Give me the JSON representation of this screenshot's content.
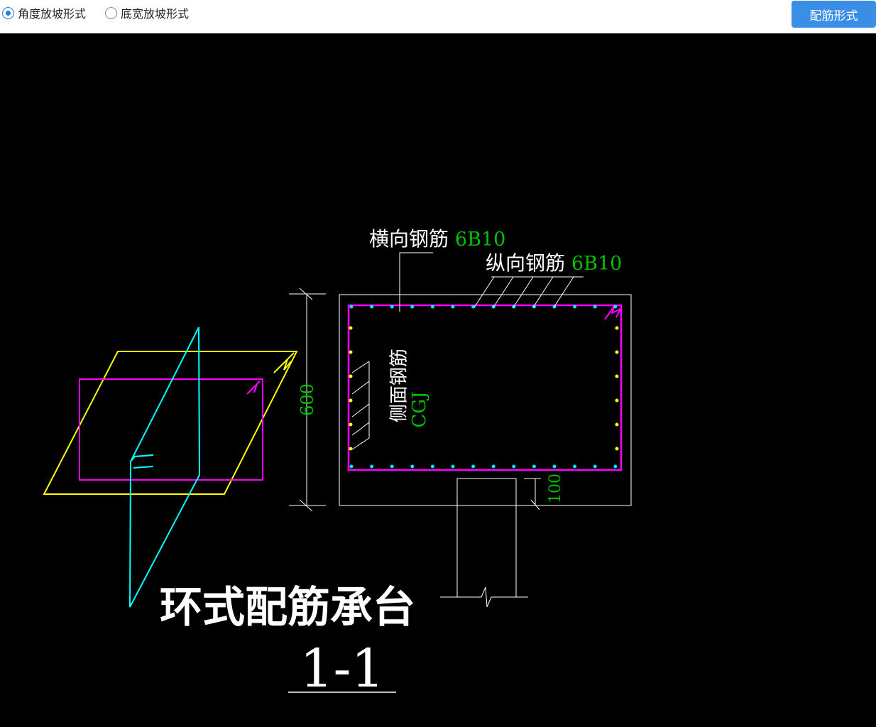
{
  "toolbar": {
    "radio_options": [
      {
        "label": "角度放坡形式",
        "checked": true
      },
      {
        "label": "底宽放坡形式",
        "checked": false
      }
    ],
    "rebar_form_button": "配筋形式"
  },
  "drawing": {
    "transverse_label": "横向钢筋",
    "transverse_spec": "6B10",
    "longitudinal_label": "纵向钢筋",
    "longitudinal_spec": "6B10",
    "side_label": "侧面钢筋",
    "side_spec": "CGJ",
    "height_dim": "600",
    "cover_dim": "100",
    "title": "环式配筋承台",
    "section": "1-1"
  },
  "colors": {
    "spec_green": "#00c000",
    "outline_white": "#ffffff",
    "rebar_magenta": "#ff00ff",
    "dot_cyan": "#00e5ff",
    "dot_yellow": "#ffff00",
    "plan_yellow": "#ffff00",
    "plan_cyan": "#00ffff",
    "button_blue": "#3a8ee6"
  }
}
